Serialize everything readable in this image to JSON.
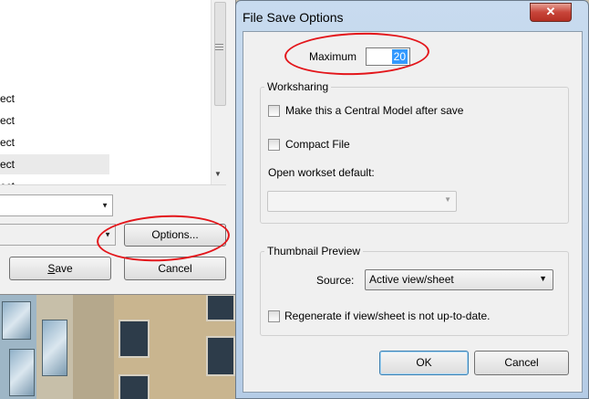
{
  "under_window": {
    "list_items": [
      "ect",
      "ect",
      "ect",
      "ect",
      "ect"
    ],
    "options_label": "Options...",
    "save_label": "Save",
    "save_mnemonic": "S",
    "save_rest": "ave",
    "cancel_label": "Cancel"
  },
  "dialog": {
    "title": "File Save Options",
    "close_glyph": "✕",
    "maximum_label": "Maximum",
    "maximum_value": "20",
    "worksharing": {
      "title": "Worksharing",
      "central_model_label": "Make this a Central Model after save",
      "central_model_checked": false,
      "compact_file_label": "Compact File",
      "compact_file_checked": false,
      "open_workset_label": "Open workset default:",
      "open_workset_value": ""
    },
    "thumbnail": {
      "title": "Thumbnail Preview",
      "source_label": "Source:",
      "source_value": "Active view/sheet",
      "regenerate_label": "Regenerate if view/sheet is not up-to-date.",
      "regenerate_checked": false
    },
    "ok_label": "OK",
    "cancel_label": "Cancel"
  },
  "icons": {
    "dropdown": "chevron-down-icon",
    "close": "close-icon"
  },
  "colors": {
    "annotation": "#e3161b",
    "selection": "#3399ff",
    "title_bar": "#bfd3ea"
  }
}
